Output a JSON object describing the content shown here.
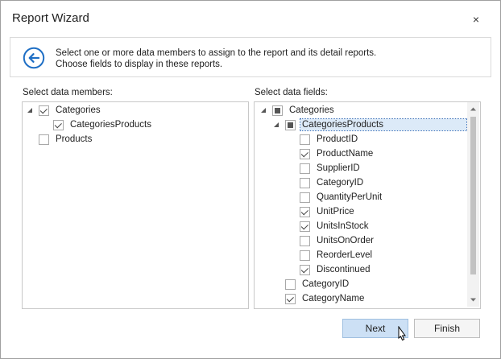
{
  "window": {
    "title": "Report Wizard",
    "close_glyph": "×"
  },
  "header": {
    "back_icon": "arrow-left-circle-icon",
    "line1": "Select one or more data members to assign to the report and its detail reports.",
    "line2": "Choose fields to display in these reports."
  },
  "members": {
    "label": "Select data members:",
    "items": [
      {
        "text": "Categories",
        "state": "checked",
        "expanded": true
      },
      {
        "text": "CategoriesProducts",
        "state": "checked"
      },
      {
        "text": "Products",
        "state": "unchecked"
      }
    ]
  },
  "fields": {
    "label": "Select data fields:",
    "items": [
      {
        "text": "Categories",
        "state": "indeterminate",
        "expanded": true
      },
      {
        "text": "CategoriesProducts",
        "state": "indeterminate",
        "expanded": true,
        "selected": true
      },
      {
        "text": "ProductID",
        "state": "unchecked"
      },
      {
        "text": "ProductName",
        "state": "checked"
      },
      {
        "text": "SupplierID",
        "state": "unchecked"
      },
      {
        "text": "CategoryID",
        "state": "unchecked"
      },
      {
        "text": "QuantityPerUnit",
        "state": "unchecked"
      },
      {
        "text": "UnitPrice",
        "state": "checked"
      },
      {
        "text": "UnitsInStock",
        "state": "checked"
      },
      {
        "text": "UnitsOnOrder",
        "state": "unchecked"
      },
      {
        "text": "ReorderLevel",
        "state": "unchecked"
      },
      {
        "text": "Discontinued",
        "state": "checked"
      },
      {
        "text": "CategoryID",
        "state": "unchecked"
      },
      {
        "text": "CategoryName",
        "state": "checked"
      }
    ]
  },
  "buttons": {
    "next": "Next",
    "finish": "Finish"
  },
  "colors": {
    "accent": "#1f6fc5",
    "selection": "#dceaf8",
    "primary_button": "#cce0f5"
  }
}
